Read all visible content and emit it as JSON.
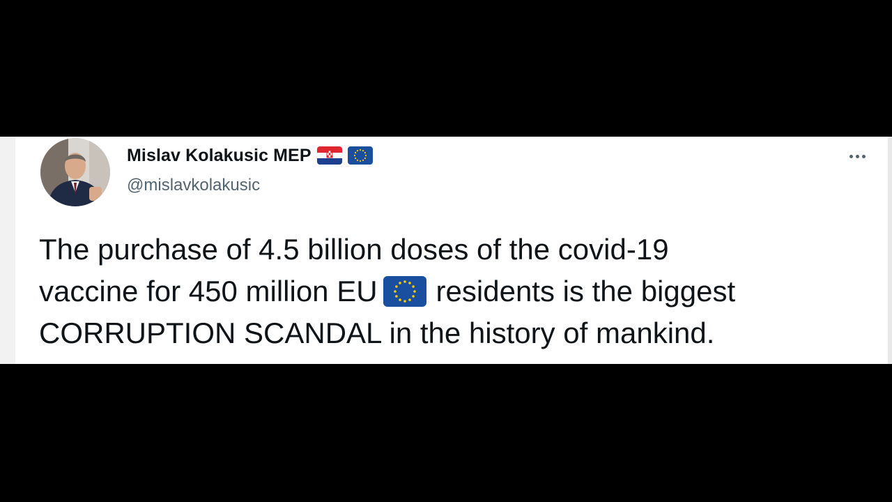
{
  "tweet": {
    "author": {
      "display_name": "Mislav Kolakusic MEP",
      "handle": "@mislavkolakusic",
      "flags": [
        "croatia-flag-icon",
        "eu-flag-icon"
      ]
    },
    "text": {
      "line1": "The purchase of 4.5 billion doses of the covid-19",
      "line2_before_flag": "vaccine for 450 million EU",
      "line2_after_flag": "residents is the biggest",
      "line3": "CORRUPTION SCANDAL in the history of mankind."
    },
    "more_icon": "more-horizontal-icon"
  },
  "colors": {
    "background": "#000000",
    "card": "#ffffff",
    "text": "#0f1419",
    "secondary": "#536471",
    "eu_blue": "#1a4fa0",
    "eu_star": "#ffcc00"
  }
}
